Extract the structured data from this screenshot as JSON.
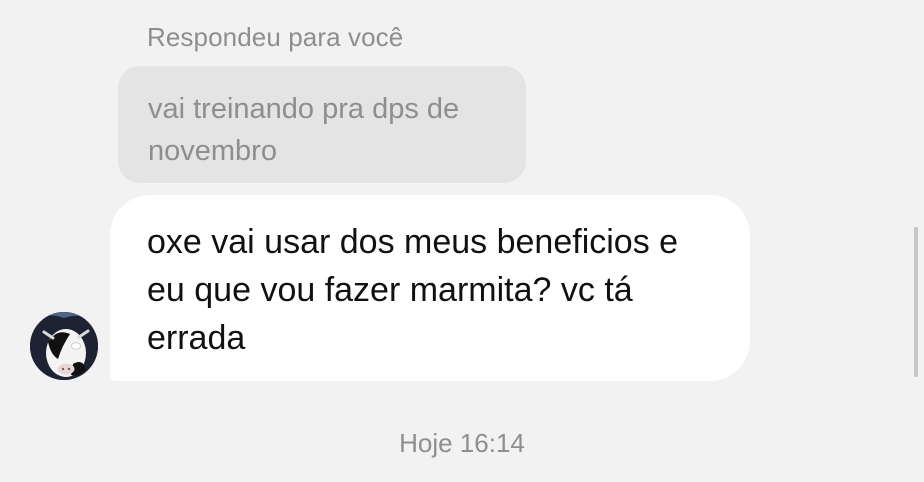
{
  "thread": {
    "reply_label": "Respondeu para você",
    "quoted_message": "vai treinando pra dps de novembro",
    "message": "oxe vai usar dos meus beneficios e eu que vou fazer marmita? vc tá errada",
    "timestamp": "Hoje 16:14"
  },
  "avatar": {
    "icon": "cow-avatar-icon"
  },
  "colors": {
    "background": "#f2f2f2",
    "quoted_bubble": "#e4e4e4",
    "message_bubble": "#ffffff",
    "muted_text": "#8e8e8e",
    "message_text": "#111111"
  }
}
